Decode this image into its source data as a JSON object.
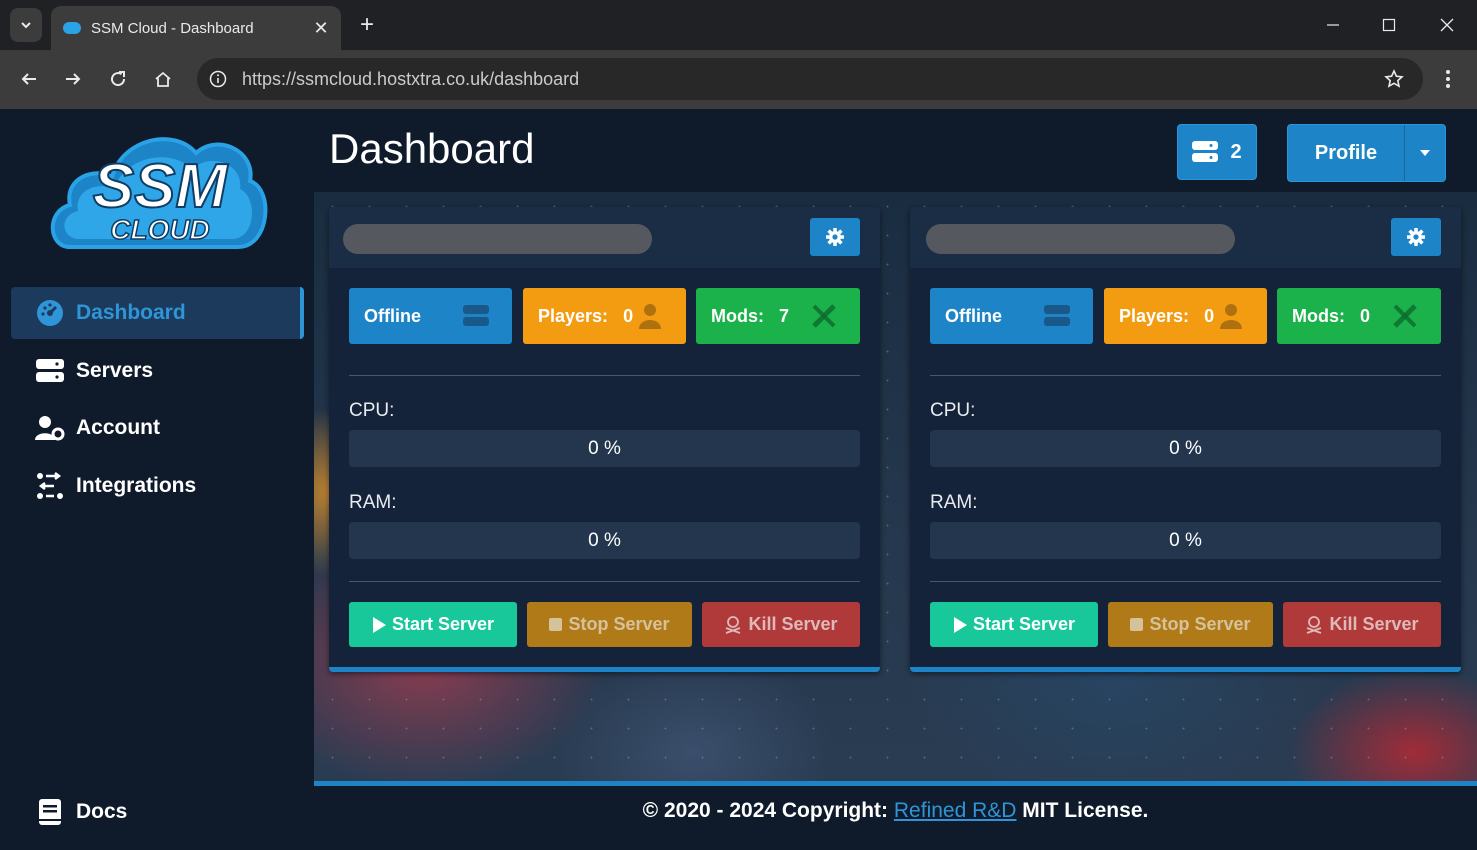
{
  "browser": {
    "tab_title": "SSM Cloud - Dashboard",
    "url": "https://ssmcloud.hostxtra.co.uk/dashboard"
  },
  "sidebar": {
    "logo_line1": "SSM",
    "logo_line2": "CLOUD",
    "items": [
      {
        "label": "Dashboard",
        "icon": "gauge-icon",
        "active": true
      },
      {
        "label": "Servers",
        "icon": "servers-icon",
        "active": false
      },
      {
        "label": "Account",
        "icon": "user-gear-icon",
        "active": false
      },
      {
        "label": "Integrations",
        "icon": "integrations-icon",
        "active": false
      }
    ],
    "docs_label": "Docs"
  },
  "header": {
    "title": "Dashboard",
    "server_count": "2",
    "profile_label": "Profile"
  },
  "cards": [
    {
      "status": "Offline",
      "players_label": "Players:",
      "players": "0",
      "mods_label": "Mods:",
      "mods": "7",
      "cpu_label": "CPU:",
      "cpu": "0 %",
      "ram_label": "RAM:",
      "ram": "0 %",
      "start_label": "Start Server",
      "stop_label": "Stop Server",
      "kill_label": "Kill Server"
    },
    {
      "status": "Offline",
      "players_label": "Players:",
      "players": "0",
      "mods_label": "Mods:",
      "mods": "0",
      "cpu_label": "CPU:",
      "cpu": "0 %",
      "ram_label": "RAM:",
      "ram": "0 %",
      "start_label": "Start Server",
      "stop_label": "Stop Server",
      "kill_label": "Kill Server"
    }
  ],
  "footer": {
    "prefix": "© 2020 - 2024 Copyright:",
    "link": "Refined R&D",
    "suffix": "MIT License."
  },
  "colors": {
    "primary": "#1e84c8",
    "warning": "#f39c12",
    "success": "#1bb14b",
    "start": "#18c79a",
    "stop": "#b07a18",
    "kill": "#b03a3a",
    "background": "#0f1b2b"
  }
}
